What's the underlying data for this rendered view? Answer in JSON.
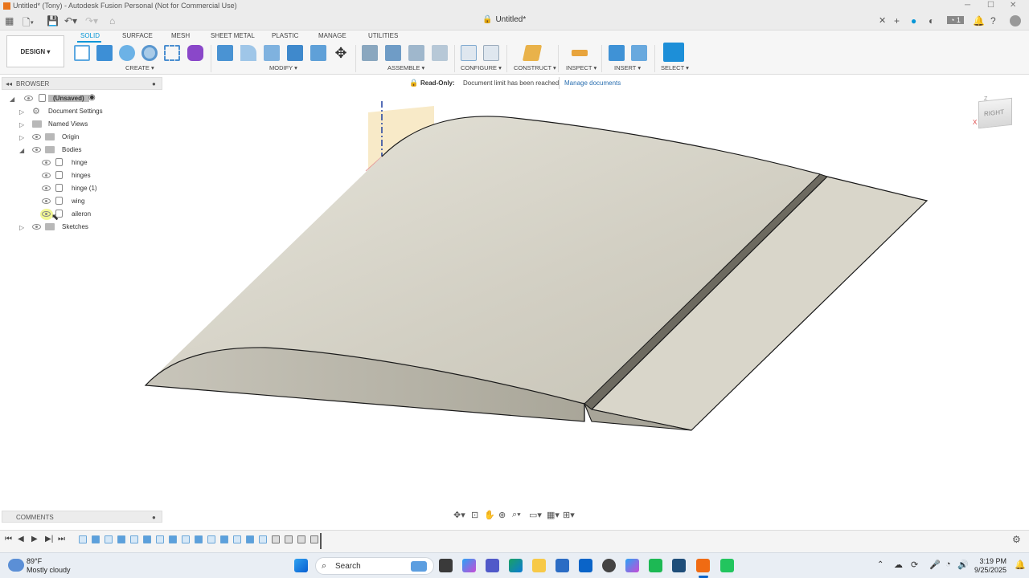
{
  "window": {
    "title": "Untitled* (Tony) - Autodesk Fusion Personal (Not for Commercial Use)",
    "document_tab": "Untitled*"
  },
  "ribbon": {
    "workspace": "DESIGN",
    "tabs": [
      "SOLID",
      "SURFACE",
      "MESH",
      "SHEET METAL",
      "PLASTIC",
      "MANAGE",
      "UTILITIES"
    ],
    "active_tab": "SOLID",
    "groups": {
      "create": "CREATE ▾",
      "modify": "MODIFY ▾",
      "assemble": "ASSEMBLE ▾",
      "configure": "CONFIGURE ▾",
      "construct": "CONSTRUCT ▾",
      "inspect": "INSPECT ▾",
      "insert": "INSERT ▾",
      "select": "SELECT ▾"
    }
  },
  "banner": {
    "readonly": "Read-Only:",
    "message": "Document limit has been reached",
    "manage_link": "Manage documents"
  },
  "browser": {
    "title": "BROWSER",
    "root": "(Unsaved)",
    "document_settings": "Document Settings",
    "named_views": "Named Views",
    "origin": "Origin",
    "bodies": "Bodies",
    "body_items": [
      "hinge",
      "hinges",
      "hinge (1)",
      "wing",
      "aileron"
    ],
    "sketches": "Sketches"
  },
  "viewcube": {
    "face": "RIGHT",
    "axis_z": "Z",
    "axis_x": "X"
  },
  "comments": {
    "title": "COMMENTS"
  },
  "taskbar": {
    "weather_temp": "89°F",
    "weather_desc": "Mostly cloudy",
    "search_placeholder": "Search",
    "time": "3:19 PM",
    "date": "9/25/2025"
  },
  "colors": {
    "accent": "#0696d7",
    "model_fill": "#d6d3c7",
    "model_edge": "#1a1a1a",
    "readonly_red": "#c0152f"
  }
}
